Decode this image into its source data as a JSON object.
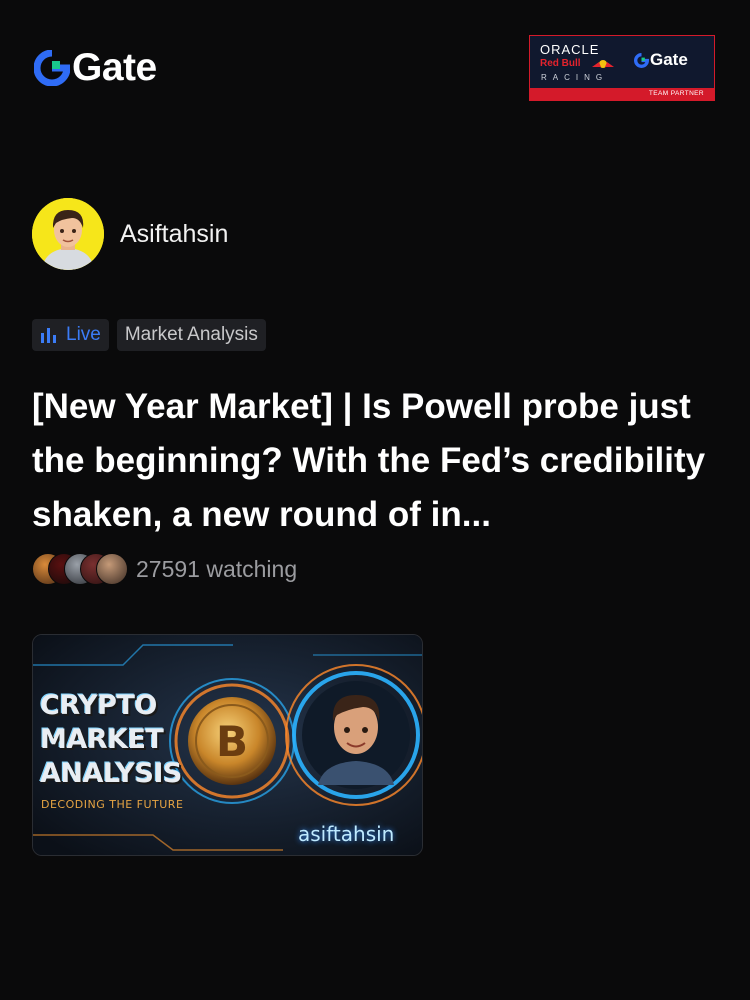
{
  "brand": {
    "name": "Gate",
    "logo_icon": "gate-logo-icon"
  },
  "partner": {
    "oracle": "ORACLE",
    "redbull": "Red Bull",
    "racing": "RACING",
    "gate": "Gate",
    "team": "TEAM PARTNER"
  },
  "author": {
    "name": "Asiftahsin",
    "avatar_icon": "user-avatar"
  },
  "tags": {
    "live": "Live",
    "category": "Market Analysis"
  },
  "post": {
    "title": "[New Year Market] | Is Powell probe just the beginning? With the Fed’s credibility shaken, a new round of in...",
    "watching": "27591 watching"
  },
  "thumbnail": {
    "line1": "CRYPTO",
    "line2": "MARKET",
    "line3": "ANALYSIS",
    "subtitle": "DECODING THE FUTURE",
    "handle": "asiftahsin"
  },
  "colors": {
    "accent": "#3b7cf6",
    "live_green": "#19c98b",
    "partner_red": "#d41a2a"
  }
}
